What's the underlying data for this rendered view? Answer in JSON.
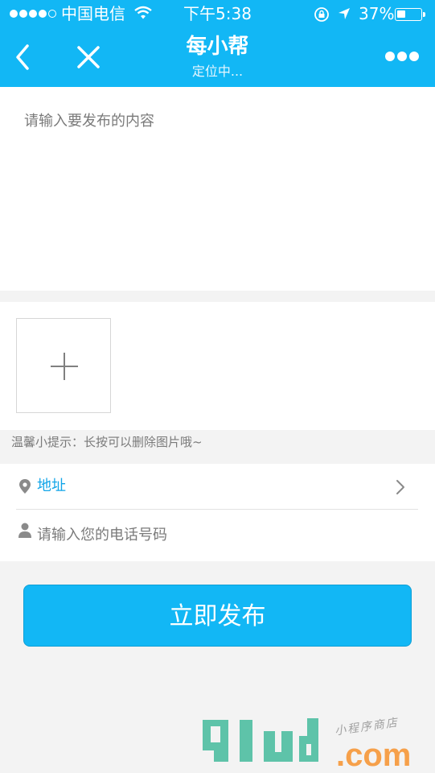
{
  "status_bar": {
    "carrier": "中国电信",
    "time": "下午5:38",
    "battery_percent": "37%",
    "signal_bars_filled": 4,
    "signal_bars_total": 5,
    "battery_level": 0.37,
    "icons": [
      "signal-icon",
      "wifi-icon",
      "rotation-lock-icon",
      "location-arrow-icon",
      "battery-icon"
    ]
  },
  "nav": {
    "title": "每小帮",
    "subtitle": "定位中...",
    "icons": [
      "back-icon",
      "close-icon",
      "more-icon"
    ]
  },
  "content": {
    "placeholder": "请输入要发布的内容"
  },
  "photos": {
    "icon": "plus-icon",
    "tip": "温馨小提示：长按可以删除图片哦~"
  },
  "address": {
    "label": "地址",
    "icons": [
      "location-pin-icon",
      "chevron-right-icon"
    ]
  },
  "phone": {
    "placeholder": "请输入您的电话号码",
    "icon": "person-icon"
  },
  "submit": {
    "label": "立即发布"
  },
  "watermark": {
    "main": "91ud",
    "suffix": ".com",
    "tagline": "小程序商店"
  },
  "colors": {
    "accent": "#12b7f5",
    "link": "#12a5e8",
    "background": "#f3f3f3",
    "watermark_green": "#5ec3a9",
    "watermark_orange": "#f6a04a"
  }
}
